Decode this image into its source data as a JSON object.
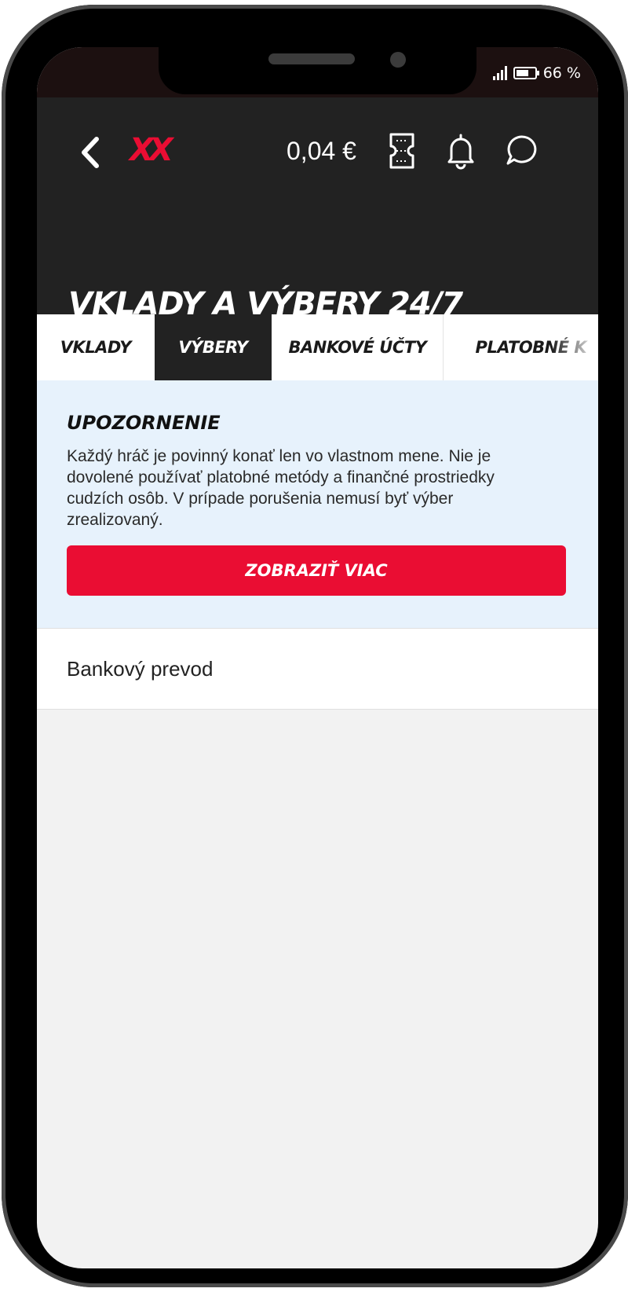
{
  "status_bar": {
    "battery_text": "66 %",
    "battery_level": 0.66
  },
  "header": {
    "logo_text": "XX",
    "balance": "0,04 €",
    "title": "VKLADY A VÝBERY 24/7"
  },
  "tabs": [
    {
      "label": "VKLADY",
      "active": false
    },
    {
      "label": "VÝBERY",
      "active": true
    },
    {
      "label": "BANKOVÉ ÚČTY",
      "active": false
    },
    {
      "label": "PLATOBNÉ K",
      "active": false
    }
  ],
  "notice": {
    "title": "UPOZORNENIE",
    "text": "Každý hráč je povinný konať len vo vlastnom mene. Nie je dovolené používať platobné metódy a finančné prostriedky cudzích osôb. V prípade porušenia nemusí byť výber zrealizovaný.",
    "button_label": "ZOBRAZIŤ VIAC"
  },
  "methods": [
    {
      "label": "Bankový prevod"
    }
  ],
  "colors": {
    "brand_red": "#ea0d33",
    "header_dark": "#222222",
    "notice_bg": "#e7f2fc"
  }
}
